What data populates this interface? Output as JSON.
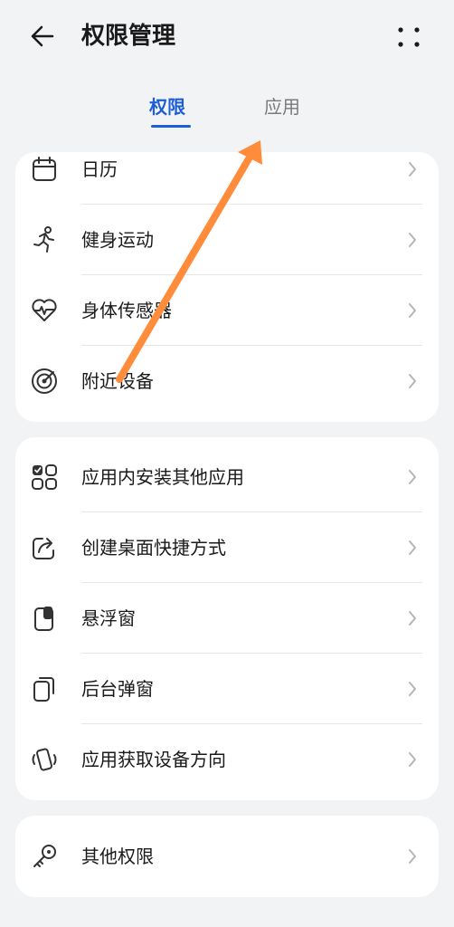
{
  "header": {
    "title": "权限管理",
    "back_icon": "back-arrow-icon",
    "more_icon": "more-dots-icon"
  },
  "tabs": [
    {
      "label": "权限",
      "active": true
    },
    {
      "label": "应用",
      "active": false
    }
  ],
  "groups": [
    {
      "items": [
        {
          "label": "日历",
          "icon": "calendar-icon"
        },
        {
          "label": "健身运动",
          "icon": "running-icon"
        },
        {
          "label": "身体传感器",
          "icon": "heart-rate-icon"
        },
        {
          "label": "附近设备",
          "icon": "radar-icon"
        }
      ]
    },
    {
      "items": [
        {
          "label": "应用内安装其他应用",
          "icon": "app-grid-icon"
        },
        {
          "label": "创建桌面快捷方式",
          "icon": "shortcut-share-icon"
        },
        {
          "label": "悬浮窗",
          "icon": "floating-window-icon"
        },
        {
          "label": "后台弹窗",
          "icon": "background-popup-icon"
        },
        {
          "label": "应用获取设备方向",
          "icon": "device-orientation-icon"
        }
      ]
    },
    {
      "items": [
        {
          "label": "其他权限",
          "icon": "key-icon"
        }
      ]
    }
  ],
  "colors": {
    "accent": "#1f5fd6",
    "background": "#f1f3f5",
    "overlay_arrow": "#ff8c3a"
  }
}
